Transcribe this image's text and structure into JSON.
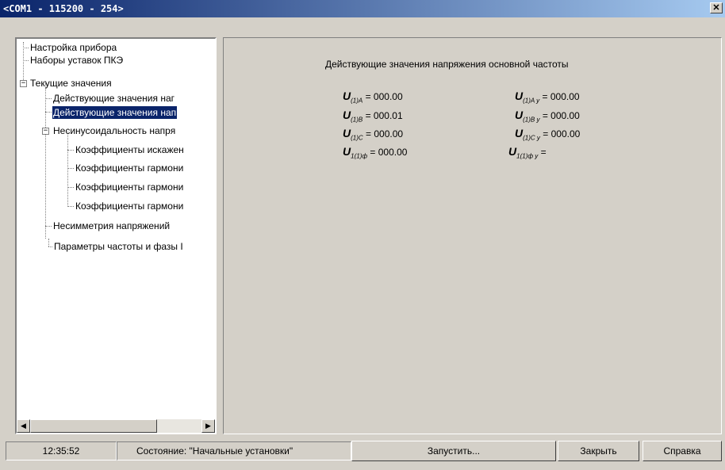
{
  "window": {
    "title": "<COM1 - 115200 - 254>",
    "close_glyph": "✕"
  },
  "tree": {
    "items": [
      {
        "label": "Настройка прибора"
      },
      {
        "label": "Наборы уставок ПКЭ"
      },
      {
        "label": "Текущие значения"
      },
      {
        "label": "Действующие значения наг"
      },
      {
        "label": "Действующие значения нап"
      },
      {
        "label": "Несинусоидальность напря"
      },
      {
        "label": "Коэффициенты искажен"
      },
      {
        "label": "Коэффициенты гармони"
      },
      {
        "label": "Коэффициенты гармони"
      },
      {
        "label": "Коэффициенты гармони"
      },
      {
        "label": "Несимметрия напряжений"
      },
      {
        "label": "Параметры частоты и фазы I"
      }
    ],
    "expander_glyph": "−",
    "scroll_left_glyph": "◀",
    "scroll_right_glyph": "▶"
  },
  "panel": {
    "title": "Действующие значения напряжения основной частоты",
    "symbol": "U",
    "rows": [
      {
        "left_sub": "(1)A",
        "left_val": "= 000.00",
        "right_sub": "(1)A y",
        "right_val": "= 000.00"
      },
      {
        "left_sub": "(1)B",
        "left_val": "= 000.01",
        "right_sub": "(1)B y",
        "right_val": "= 000.00"
      },
      {
        "left_sub": "(1)C",
        "left_val": "= 000.00",
        "right_sub": "(1)C y",
        "right_val": "= 000.00"
      },
      {
        "left_sub": "1(1)ф",
        "left_val": "= 000.00",
        "right_sub": "1(1)ф y",
        "right_val": "="
      }
    ]
  },
  "statusbar": {
    "time": "12:35:52",
    "state": "Состояние: \"Начальные установки\"",
    "start_button": "Запустить...",
    "close_button": "Закрыть",
    "help_button": "Справка"
  }
}
